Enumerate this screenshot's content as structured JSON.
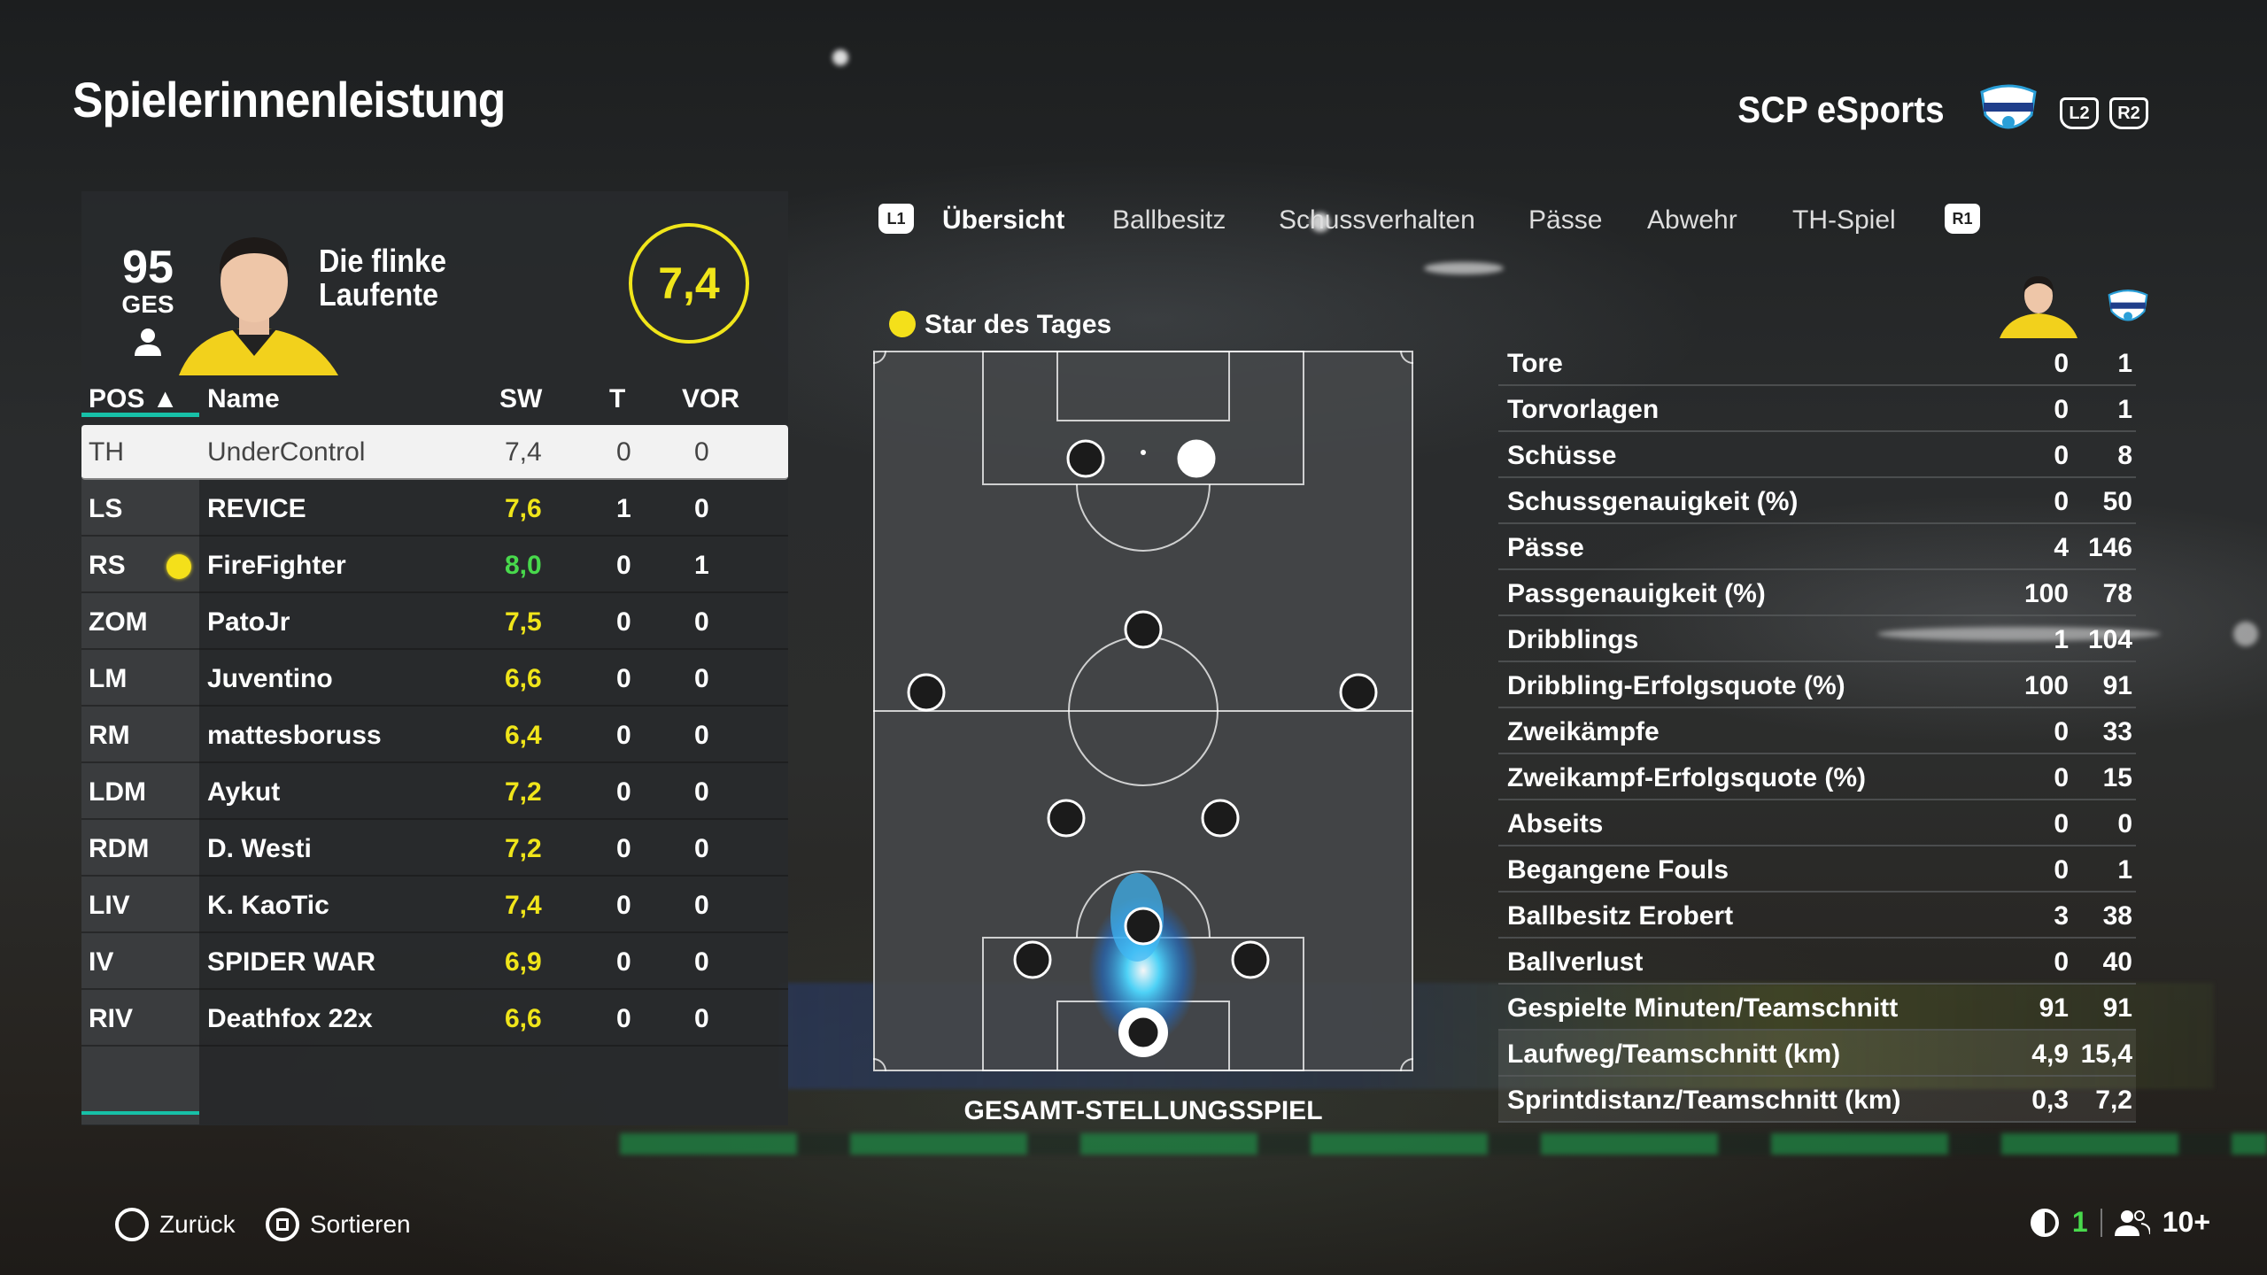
{
  "header": {
    "title": "Spielerinnenleistung",
    "club_name": "SCP eSports",
    "badge_icon": "scp-paderborn-badge-icon",
    "l2_label": "L2",
    "r2_label": "R2"
  },
  "player_card": {
    "overall": "95",
    "overall_label": "GES",
    "nickname_line1": "Die flinke",
    "nickname_line2": "Laufente",
    "rating": "7,4",
    "rating_color": "#f0e51a"
  },
  "table": {
    "headers": {
      "pos": "POS ▲",
      "name": "Name",
      "sw": "SW",
      "t": "T",
      "vor": "VOR"
    },
    "rows": [
      {
        "pos": "TH",
        "name": "UnderControl",
        "sw": "7,4",
        "t": "0",
        "vor": "0",
        "selected": true
      },
      {
        "pos": "LS",
        "name": "REVICE",
        "sw": "7,6",
        "t": "1",
        "vor": "0"
      },
      {
        "pos": "RS",
        "name": "FireFighter",
        "sw": "8,0",
        "t": "0",
        "vor": "1",
        "star": true
      },
      {
        "pos": "ZOM",
        "name": "PatoJr",
        "sw": "7,5",
        "t": "0",
        "vor": "0"
      },
      {
        "pos": "LM",
        "name": "Juventino",
        "sw": "6,6",
        "t": "0",
        "vor": "0"
      },
      {
        "pos": "RM",
        "name": "mattesboruss",
        "sw": "6,4",
        "t": "0",
        "vor": "0"
      },
      {
        "pos": "LDM",
        "name": "Aykut",
        "sw": "7,2",
        "t": "0",
        "vor": "0"
      },
      {
        "pos": "RDM",
        "name": "D. Westi",
        "sw": "7,2",
        "t": "0",
        "vor": "0"
      },
      {
        "pos": "LIV",
        "name": "K. KaoTic",
        "sw": "7,4",
        "t": "0",
        "vor": "0"
      },
      {
        "pos": "IV",
        "name": "SPIDER WAR",
        "sw": "6,9",
        "t": "0",
        "vor": "0"
      },
      {
        "pos": "RIV",
        "name": "Deathfox 22x",
        "sw": "6,6",
        "t": "0",
        "vor": "0"
      }
    ]
  },
  "tabs": {
    "l1": "L1",
    "r1": "R1",
    "items": [
      "Übersicht",
      "Ballbesitz",
      "Schussverhalten",
      "Pässe",
      "Abwehr",
      "TH-Spiel"
    ],
    "active": "Übersicht"
  },
  "pitch": {
    "star_label": "Star des Tages",
    "caption": "GESAMT-STELLUNGSSPIEL"
  },
  "stats": [
    {
      "label": "Tore",
      "player": "0",
      "team": "1"
    },
    {
      "label": "Torvorlagen",
      "player": "0",
      "team": "1"
    },
    {
      "label": "Schüsse",
      "player": "0",
      "team": "8"
    },
    {
      "label": "Schussgenauigkeit (%)",
      "player": "0",
      "team": "50"
    },
    {
      "label": "Pässe",
      "player": "4",
      "team": "146"
    },
    {
      "label": "Passgenauigkeit (%)",
      "player": "100",
      "team": "78"
    },
    {
      "label": "Dribblings",
      "player": "1",
      "team": "104"
    },
    {
      "label": "Dribbling-Erfolgsquote (%)",
      "player": "100",
      "team": "91"
    },
    {
      "label": "Zweikämpfe",
      "player": "0",
      "team": "33"
    },
    {
      "label": "Zweikampf-Erfolgsquote (%)",
      "player": "0",
      "team": "15"
    },
    {
      "label": "Abseits",
      "player": "0",
      "team": "0"
    },
    {
      "label": "Begangene Fouls",
      "player": "0",
      "team": "1"
    },
    {
      "label": "Ballbesitz Erobert",
      "player": "3",
      "team": "38"
    },
    {
      "label": "Ballverlust",
      "player": "0",
      "team": "40"
    },
    {
      "label": "Gespielte Minuten/Teamschnitt",
      "player": "91",
      "team": "91"
    },
    {
      "label": "Laufweg/Teamschnitt (km)",
      "player": "4,9",
      "team": "15,4"
    },
    {
      "label": "Sprintdistanz/Teamschnitt (km)",
      "player": "0,3",
      "team": "7,2"
    }
  ],
  "footer": {
    "back_label": "Zurück",
    "sort_label": "Sortieren",
    "count_a": "1",
    "count_b": "10+"
  }
}
